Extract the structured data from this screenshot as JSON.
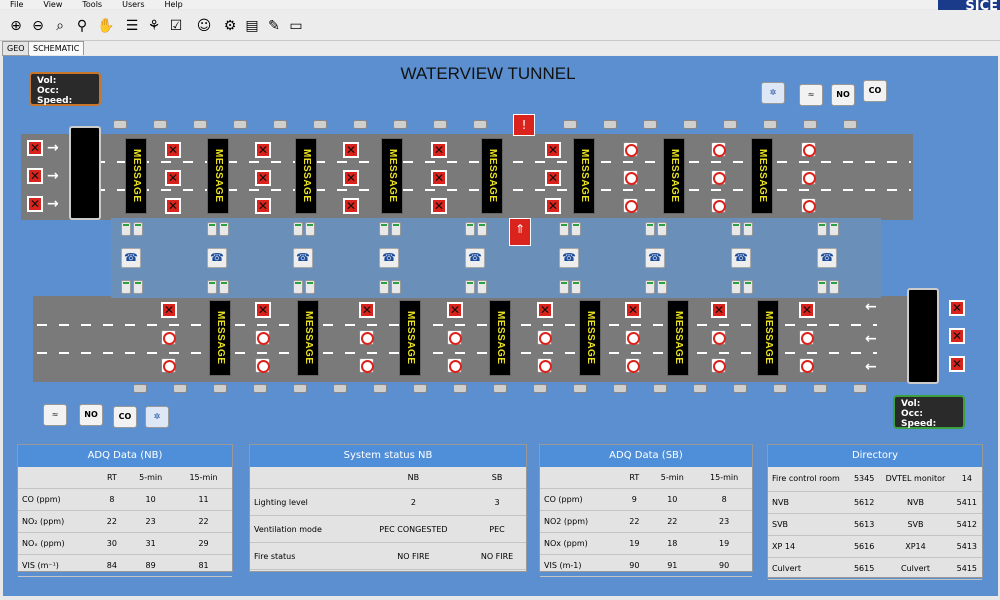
{
  "menu": [
    "File",
    "View",
    "Tools",
    "Users",
    "Help"
  ],
  "brand": "SICE",
  "tabs": [
    "GEO",
    "SCHEMATIC"
  ],
  "title": "WATERVIEW TUNNEL",
  "vol_box": {
    "vol": "Vol:",
    "occ": "Occ:",
    "speed": "Speed:"
  },
  "message_text": "MESSAGE",
  "status_icons": {
    "no": "NO",
    "co": "CO"
  },
  "adq_nb": {
    "title": "ADQ Data (NB)",
    "headers": [
      "",
      "RT",
      "5-min",
      "15-min"
    ],
    "rows": [
      [
        "CO (ppm)",
        "8",
        "10",
        "11"
      ],
      [
        "NO₂ (ppm)",
        "22",
        "23",
        "22"
      ],
      [
        "NOₓ (ppm)",
        "30",
        "31",
        "29"
      ],
      [
        "VIS (m⁻¹)",
        "84",
        "89",
        "81"
      ]
    ]
  },
  "system_nb": {
    "title": "System status NB",
    "headers": [
      "",
      "NB",
      "SB"
    ],
    "rows": [
      [
        "Lighting level",
        "2",
        "3"
      ],
      [
        "Ventilation mode",
        "PEC CONGESTED",
        "PEC"
      ],
      [
        "Fire status",
        "NO FIRE",
        "NO FIRE"
      ]
    ]
  },
  "adq_sb": {
    "title": "ADQ Data (SB)",
    "headers": [
      "",
      "RT",
      "5-min",
      "15-min"
    ],
    "rows": [
      [
        "CO (ppm)",
        "9",
        "10",
        "8"
      ],
      [
        "NO2 (ppm)",
        "22",
        "22",
        "23"
      ],
      [
        "NOx (ppm)",
        "19",
        "18",
        "19"
      ],
      [
        "VIS (m-1)",
        "90",
        "91",
        "90"
      ]
    ]
  },
  "directory": {
    "title": "Directory",
    "rows": [
      [
        "Fire control room",
        "5345",
        "DVTEL monitor",
        "14"
      ],
      [
        "NVB",
        "5612",
        "NVB",
        "5411"
      ],
      [
        "SVB",
        "5613",
        "SVB",
        "5412"
      ],
      [
        "XP 14",
        "5616",
        "XP14",
        "5413"
      ],
      [
        "Culvert",
        "5615",
        "Culvert",
        "5415"
      ]
    ]
  },
  "colors": {
    "canvas_bg": "#5b8fcf",
    "panel_header": "#4f8fda",
    "sign_text": "#e8e020",
    "lane_closed": "#d9231c"
  }
}
